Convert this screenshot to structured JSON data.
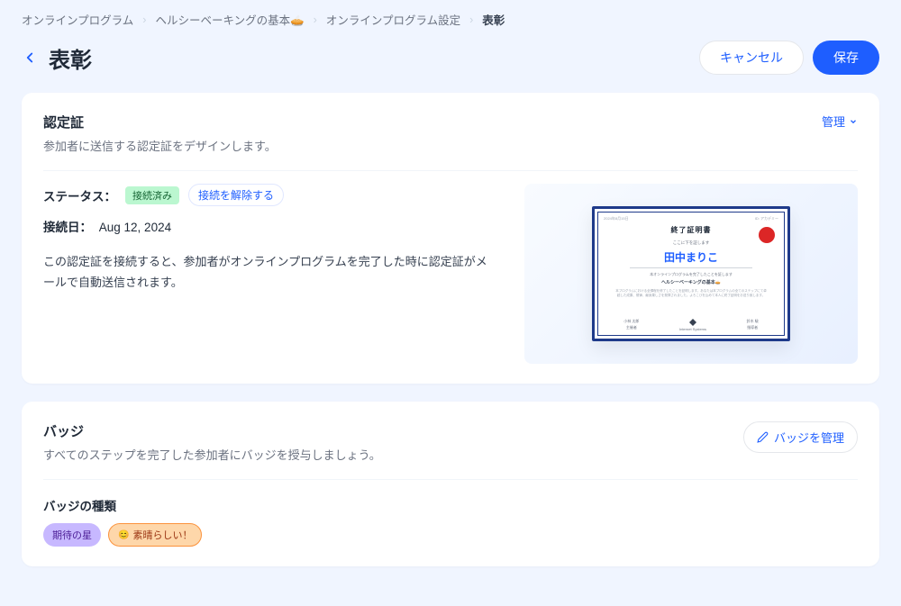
{
  "breadcrumb": {
    "item1": "オンラインプログラム",
    "item2": "ヘルシーベーキングの基本🥧",
    "item3": "オンラインプログラム設定",
    "item4": "表彰"
  },
  "header": {
    "title": "表彰",
    "cancel": "キャンセル",
    "save": "保存"
  },
  "cert": {
    "title": "認定証",
    "desc": "参加者に送信する認定証をデザインします。",
    "manage": "管理",
    "status_label": "ステータス：",
    "status_value": "接続済み",
    "disconnect": "接続を解除する",
    "date_label": "接続日：",
    "date_value": "Aug 12, 2024",
    "note": "この認定証を接続すると、参加者がオンラインプログラムを完了した時に認定証がメールで自動送信されます。",
    "preview": {
      "corner_left": "2024年8月15日",
      "corner_right": "ID: アカデミー",
      "title": "終了証明書",
      "sub": "ここに下を証します",
      "name": "田中まりこ",
      "completion": "本オンラインプログラムを完了したことを証します",
      "course": "ヘルシーベーキングの基本🥧",
      "desc": "本プログラムにおける全課程を修了したことを証明します。あなたは本プログラムの全てのステップにて卓越した成果、規律、献身果しさを発揮されました。よろこびを込めて本人に終了証明をお送り致します。",
      "sig1_name": "小林 太郎",
      "sig1_title": "主催者",
      "sig2_name": "Internet Systems",
      "sig3_name": "鈴木 駿",
      "sig3_title": "指導者"
    }
  },
  "badge": {
    "title": "バッジ",
    "desc": "すべてのステップを完了した参加者にバッジを授与しましょう。",
    "manage": "バッジを管理",
    "types_label": "バッジの種類",
    "item1": "期待の星",
    "item2": "素晴らしい！"
  }
}
